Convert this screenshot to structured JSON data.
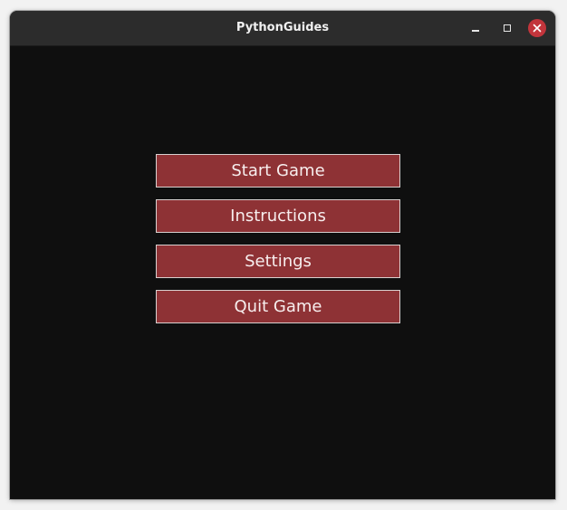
{
  "window": {
    "title": "PythonGuides"
  },
  "menu": {
    "buttons": [
      {
        "label": "Start Game"
      },
      {
        "label": "Instructions"
      },
      {
        "label": "Settings"
      },
      {
        "label": "Quit Game"
      }
    ]
  },
  "colors": {
    "background": "#0f0f0f",
    "titlebar": "#2c2c2c",
    "button_fill": "#8e3235",
    "button_border": "#d8d0cf",
    "close_button": "#c2353c"
  },
  "icons": {
    "minimize": "minimize-icon",
    "maximize": "maximize-icon",
    "close": "close-icon"
  }
}
